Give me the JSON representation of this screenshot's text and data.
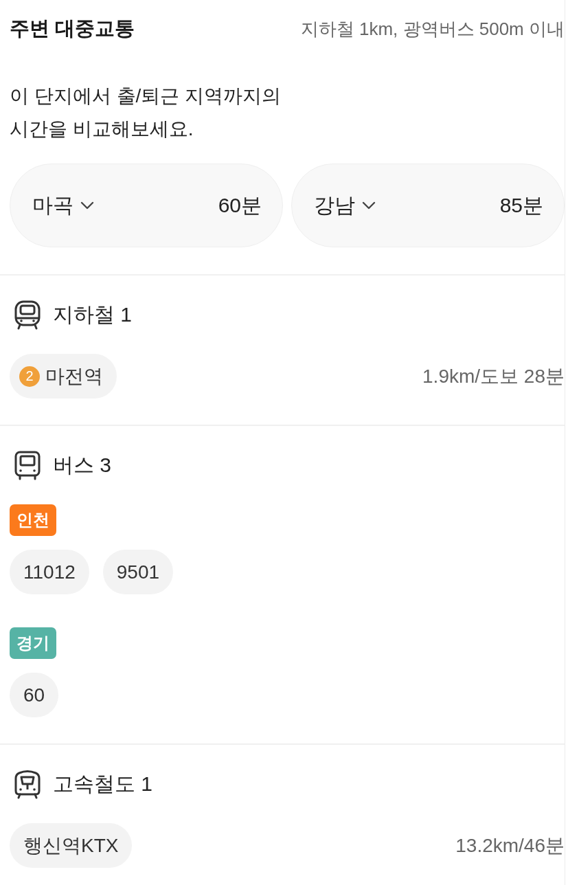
{
  "header": {
    "title": "주변 대중교통",
    "criteria": "지하철 1km, 광역버스 500m 이내"
  },
  "commute": {
    "description": "이 단지에서 출/퇴근 지역까지의\n시간을 비교해보세요.",
    "destinations": [
      {
        "name": "마곡",
        "time": "60분"
      },
      {
        "name": "강남",
        "time": "85분"
      }
    ]
  },
  "sections": [
    {
      "kind": "subway",
      "title": "지하철 1",
      "stations": [
        {
          "line": "2",
          "color": "#f0a03a",
          "name": "마전역",
          "distance": "1.9km/도보 28분"
        }
      ]
    },
    {
      "kind": "bus",
      "title": "버스 3",
      "groups": [
        {
          "region": "인천",
          "color": "#fb7a1c",
          "routes": [
            "11012",
            "9501"
          ]
        },
        {
          "region": "경기",
          "color": "#56b3a5",
          "routes": [
            "60"
          ]
        }
      ]
    },
    {
      "kind": "rail",
      "title": "고속철도 1",
      "stations": [
        {
          "name": "행신역KTX",
          "distance": "13.2km/46분"
        }
      ]
    }
  ]
}
